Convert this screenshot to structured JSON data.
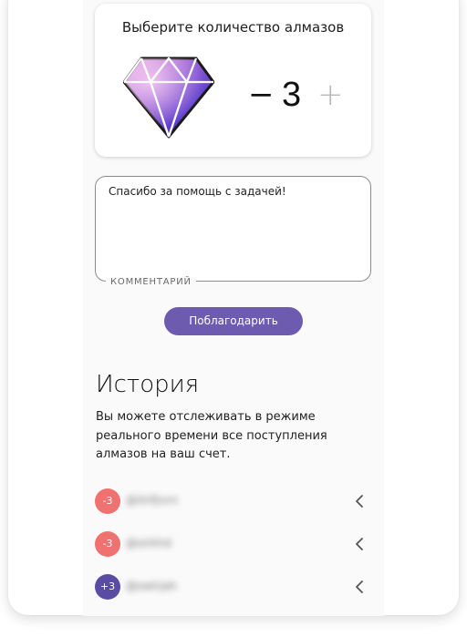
{
  "diamond_picker": {
    "title": "Выберите количество алмазов",
    "minus_label": "−",
    "count": "3",
    "plus_label": "+"
  },
  "comment": {
    "value": "Спасибо за помощь с задачей!",
    "label": "КОММЕНТАРИЙ"
  },
  "thank_button": {
    "label": "Поблагодарить"
  },
  "history": {
    "title": "История",
    "description": "Вы можете отслеживать в режиме реального времени все поступления алмазов на ваш счет.",
    "items": [
      {
        "amount": "-3",
        "name": "@ilirfjivrn",
        "color": "#f07270",
        "chevron": "chevron-left-icon"
      },
      {
        "amount": "-3",
        "name": "@oirkhd",
        "color": "#f07270",
        "chevron": "chevron-left-icon"
      },
      {
        "amount": "+3",
        "name": "@owlrjah",
        "color": "#5a4ba3",
        "chevron": "chevron-left-icon"
      }
    ]
  },
  "colors": {
    "accent": "#6d5bb0",
    "negative": "#f07270",
    "positive": "#5a4ba3"
  }
}
